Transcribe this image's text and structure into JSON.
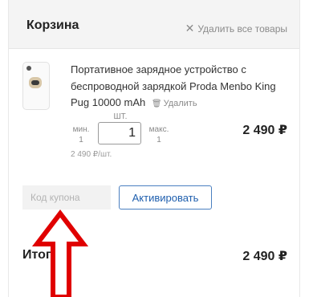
{
  "cart": {
    "title": "Корзина",
    "clear_all_label": "Удалить все товары",
    "clear_icon": "x-icon"
  },
  "item": {
    "name": "Портативное зарядное устройство с беспроводной зарядкой Proda Menbo King Pug 10000 mAh",
    "remove_label": "Удалить",
    "remove_icon": "trash-icon",
    "qty_unit": "ШТ.",
    "qty_value": "1",
    "min_label": "мин.",
    "min_value": "1",
    "max_label": "макс.",
    "max_value": "1",
    "unit_price": "2 490 ₽/шт.",
    "line_total": "2 490 ₽"
  },
  "coupon": {
    "placeholder": "Код купона",
    "activate_label": "Активировать"
  },
  "summary": {
    "total_label": "Итого",
    "total_value": "2 490 ₽"
  },
  "annotation": {
    "arrow_color": "#e00000"
  }
}
